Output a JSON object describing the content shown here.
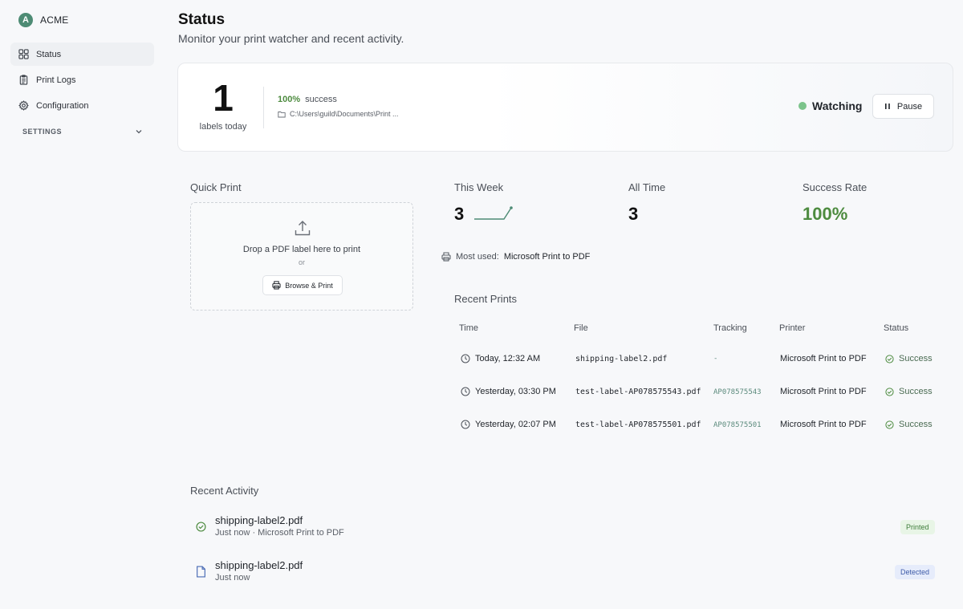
{
  "brand": {
    "logo_letter": "A",
    "name": "ACME"
  },
  "sidebar": {
    "items": [
      {
        "label": "Status",
        "icon": "grid-icon",
        "active": true
      },
      {
        "label": "Print Logs",
        "icon": "clipboard-icon"
      },
      {
        "label": "Configuration",
        "icon": "gear-icon"
      }
    ],
    "settings_label": "SETTINGS"
  },
  "header": {
    "title": "Status",
    "subtitle": "Monitor your print watcher and recent activity."
  },
  "summary": {
    "count": "1",
    "count_label": "labels today",
    "success_pct": "100%",
    "success_label": "success",
    "watch_path": "C:\\Users\\guild\\Documents\\Print ...",
    "watch_state": "Watching",
    "pause_label": "Pause"
  },
  "quick_print": {
    "title": "Quick Print",
    "drop_text": "Drop a PDF label here to print",
    "or_text": "or",
    "browse_label": "Browse & Print"
  },
  "stats": {
    "this_week": {
      "label": "This Week",
      "value": "3"
    },
    "all_time": {
      "label": "All Time",
      "value": "3"
    },
    "success_rate": {
      "label": "Success Rate",
      "value": "100%"
    },
    "most_used_label": "Most used:",
    "most_used_value": "Microsoft Print to PDF"
  },
  "recent_prints": {
    "title": "Recent Prints",
    "columns": [
      "Time",
      "File",
      "Tracking",
      "Printer",
      "Status"
    ],
    "rows": [
      {
        "time": "Today, 12:32 AM",
        "file": "shipping-label2.pdf",
        "tracking": "-",
        "printer": "Microsoft Print to PDF",
        "status": "Success"
      },
      {
        "time": "Yesterday, 03:30 PM",
        "file": "test-label-AP078575543.pdf",
        "tracking": "AP078575543",
        "printer": "Microsoft Print to PDF",
        "status": "Success"
      },
      {
        "time": "Yesterday, 02:07 PM",
        "file": "test-label-AP078575501.pdf",
        "tracking": "AP078575501",
        "printer": "Microsoft Print to PDF",
        "status": "Success"
      }
    ]
  },
  "recent_activity": {
    "title": "Recent Activity",
    "items": [
      {
        "file": "shipping-label2.pdf",
        "meta": "Just now · Microsoft Print to PDF",
        "badge": "Printed",
        "icon": "check-circle-icon"
      },
      {
        "file": "shipping-label2.pdf",
        "meta": "Just now",
        "badge": "Detected",
        "icon": "file-icon"
      }
    ]
  },
  "colors": {
    "accent": "#4d8b74",
    "success": "#4d8b3f",
    "watching_dot": "#7cc48b"
  }
}
